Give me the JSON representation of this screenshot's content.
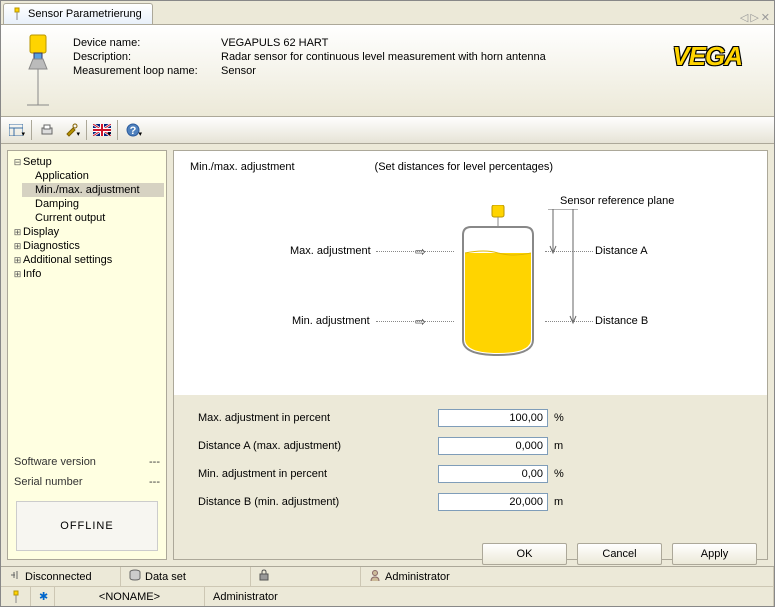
{
  "window": {
    "tab_title": "Sensor Parametrierung"
  },
  "header": {
    "device_name_label": "Device name:",
    "device_name": "VEGAPULS 62 HART",
    "description_label": "Description:",
    "description": "Radar sensor for continuous level measurement with horn antenna",
    "loop_label": "Measurement loop name:",
    "loop": "Sensor",
    "logo": "VEGA"
  },
  "tree": {
    "root": "Setup",
    "items": [
      "Application",
      "Min./max. adjustment",
      "Damping",
      "Current output"
    ],
    "selected_index": 1,
    "collapsed": [
      "Display",
      "Diagnostics",
      "Additional settings",
      "Info"
    ]
  },
  "sidebar": {
    "sw_label": "Software version",
    "sw_value": "---",
    "sn_label": "Serial number",
    "sn_value": "---",
    "offline": "OFFLINE"
  },
  "diagram": {
    "title": "Min./max. adjustment",
    "subtitle": "(Set distances for level percentages)",
    "ref_plane": "Sensor reference plane",
    "max_adj": "Max. adjustment",
    "min_adj": "Min. adjustment",
    "dist_a": "Distance A",
    "dist_b": "Distance B"
  },
  "form": {
    "rows": [
      {
        "label": "Max. adjustment in percent",
        "value": "100,00",
        "unit": "%"
      },
      {
        "label": "Distance A (max. adjustment)",
        "value": "0,000",
        "unit": "m"
      },
      {
        "label": "Min. adjustment in percent",
        "value": "0,00",
        "unit": "%"
      },
      {
        "label": "Distance B (min. adjustment)",
        "value": "20,000",
        "unit": "m"
      }
    ]
  },
  "buttons": {
    "ok": "OK",
    "cancel": "Cancel",
    "apply": "Apply"
  },
  "status": {
    "row1": [
      "Disconnected",
      "Data set",
      "",
      "Administrator"
    ],
    "row2": [
      "",
      "<NONAME>",
      "Administrator"
    ]
  }
}
